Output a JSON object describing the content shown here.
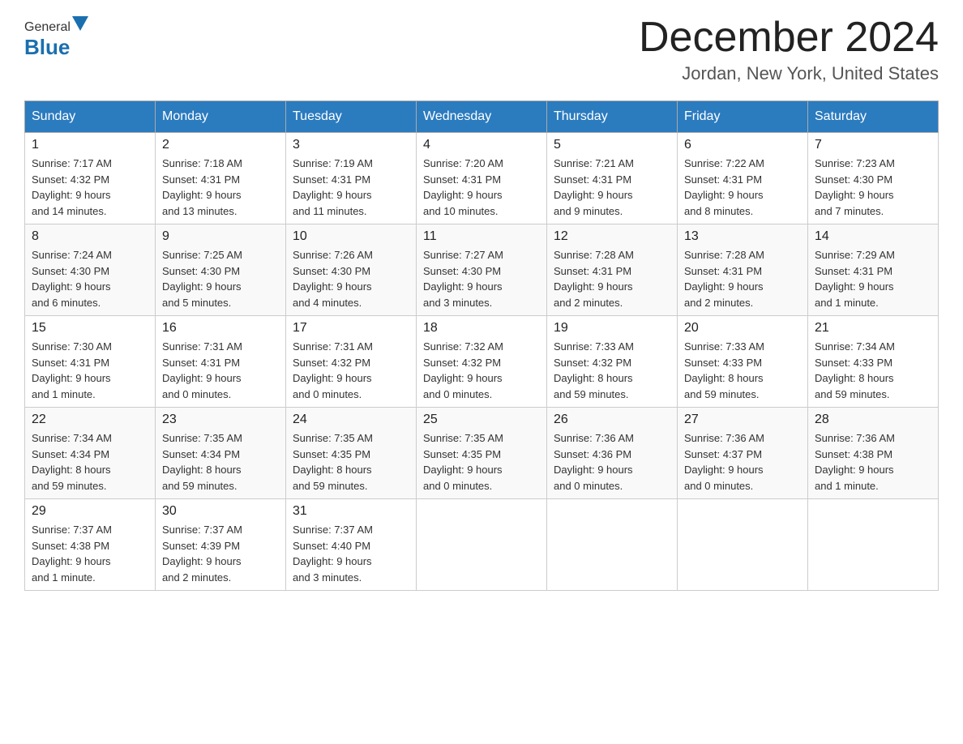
{
  "header": {
    "logo_general": "General",
    "logo_blue": "Blue",
    "month_title": "December 2024",
    "location": "Jordan, New York, United States"
  },
  "days_of_week": [
    "Sunday",
    "Monday",
    "Tuesday",
    "Wednesday",
    "Thursday",
    "Friday",
    "Saturday"
  ],
  "weeks": [
    [
      {
        "day": "1",
        "sunrise": "7:17 AM",
        "sunset": "4:32 PM",
        "daylight": "9 hours and 14 minutes."
      },
      {
        "day": "2",
        "sunrise": "7:18 AM",
        "sunset": "4:31 PM",
        "daylight": "9 hours and 13 minutes."
      },
      {
        "day": "3",
        "sunrise": "7:19 AM",
        "sunset": "4:31 PM",
        "daylight": "9 hours and 11 minutes."
      },
      {
        "day": "4",
        "sunrise": "7:20 AM",
        "sunset": "4:31 PM",
        "daylight": "9 hours and 10 minutes."
      },
      {
        "day": "5",
        "sunrise": "7:21 AM",
        "sunset": "4:31 PM",
        "daylight": "9 hours and 9 minutes."
      },
      {
        "day": "6",
        "sunrise": "7:22 AM",
        "sunset": "4:31 PM",
        "daylight": "9 hours and 8 minutes."
      },
      {
        "day": "7",
        "sunrise": "7:23 AM",
        "sunset": "4:30 PM",
        "daylight": "9 hours and 7 minutes."
      }
    ],
    [
      {
        "day": "8",
        "sunrise": "7:24 AM",
        "sunset": "4:30 PM",
        "daylight": "9 hours and 6 minutes."
      },
      {
        "day": "9",
        "sunrise": "7:25 AM",
        "sunset": "4:30 PM",
        "daylight": "9 hours and 5 minutes."
      },
      {
        "day": "10",
        "sunrise": "7:26 AM",
        "sunset": "4:30 PM",
        "daylight": "9 hours and 4 minutes."
      },
      {
        "day": "11",
        "sunrise": "7:27 AM",
        "sunset": "4:30 PM",
        "daylight": "9 hours and 3 minutes."
      },
      {
        "day": "12",
        "sunrise": "7:28 AM",
        "sunset": "4:31 PM",
        "daylight": "9 hours and 2 minutes."
      },
      {
        "day": "13",
        "sunrise": "7:28 AM",
        "sunset": "4:31 PM",
        "daylight": "9 hours and 2 minutes."
      },
      {
        "day": "14",
        "sunrise": "7:29 AM",
        "sunset": "4:31 PM",
        "daylight": "9 hours and 1 minute."
      }
    ],
    [
      {
        "day": "15",
        "sunrise": "7:30 AM",
        "sunset": "4:31 PM",
        "daylight": "9 hours and 1 minute."
      },
      {
        "day": "16",
        "sunrise": "7:31 AM",
        "sunset": "4:31 PM",
        "daylight": "9 hours and 0 minutes."
      },
      {
        "day": "17",
        "sunrise": "7:31 AM",
        "sunset": "4:32 PM",
        "daylight": "9 hours and 0 minutes."
      },
      {
        "day": "18",
        "sunrise": "7:32 AM",
        "sunset": "4:32 PM",
        "daylight": "9 hours and 0 minutes."
      },
      {
        "day": "19",
        "sunrise": "7:33 AM",
        "sunset": "4:32 PM",
        "daylight": "8 hours and 59 minutes."
      },
      {
        "day": "20",
        "sunrise": "7:33 AM",
        "sunset": "4:33 PM",
        "daylight": "8 hours and 59 minutes."
      },
      {
        "day": "21",
        "sunrise": "7:34 AM",
        "sunset": "4:33 PM",
        "daylight": "8 hours and 59 minutes."
      }
    ],
    [
      {
        "day": "22",
        "sunrise": "7:34 AM",
        "sunset": "4:34 PM",
        "daylight": "8 hours and 59 minutes."
      },
      {
        "day": "23",
        "sunrise": "7:35 AM",
        "sunset": "4:34 PM",
        "daylight": "8 hours and 59 minutes."
      },
      {
        "day": "24",
        "sunrise": "7:35 AM",
        "sunset": "4:35 PM",
        "daylight": "8 hours and 59 minutes."
      },
      {
        "day": "25",
        "sunrise": "7:35 AM",
        "sunset": "4:35 PM",
        "daylight": "9 hours and 0 minutes."
      },
      {
        "day": "26",
        "sunrise": "7:36 AM",
        "sunset": "4:36 PM",
        "daylight": "9 hours and 0 minutes."
      },
      {
        "day": "27",
        "sunrise": "7:36 AM",
        "sunset": "4:37 PM",
        "daylight": "9 hours and 0 minutes."
      },
      {
        "day": "28",
        "sunrise": "7:36 AM",
        "sunset": "4:38 PM",
        "daylight": "9 hours and 1 minute."
      }
    ],
    [
      {
        "day": "29",
        "sunrise": "7:37 AM",
        "sunset": "4:38 PM",
        "daylight": "9 hours and 1 minute."
      },
      {
        "day": "30",
        "sunrise": "7:37 AM",
        "sunset": "4:39 PM",
        "daylight": "9 hours and 2 minutes."
      },
      {
        "day": "31",
        "sunrise": "7:37 AM",
        "sunset": "4:40 PM",
        "daylight": "9 hours and 3 minutes."
      },
      null,
      null,
      null,
      null
    ]
  ],
  "labels": {
    "sunrise": "Sunrise:",
    "sunset": "Sunset:",
    "daylight": "Daylight:"
  }
}
